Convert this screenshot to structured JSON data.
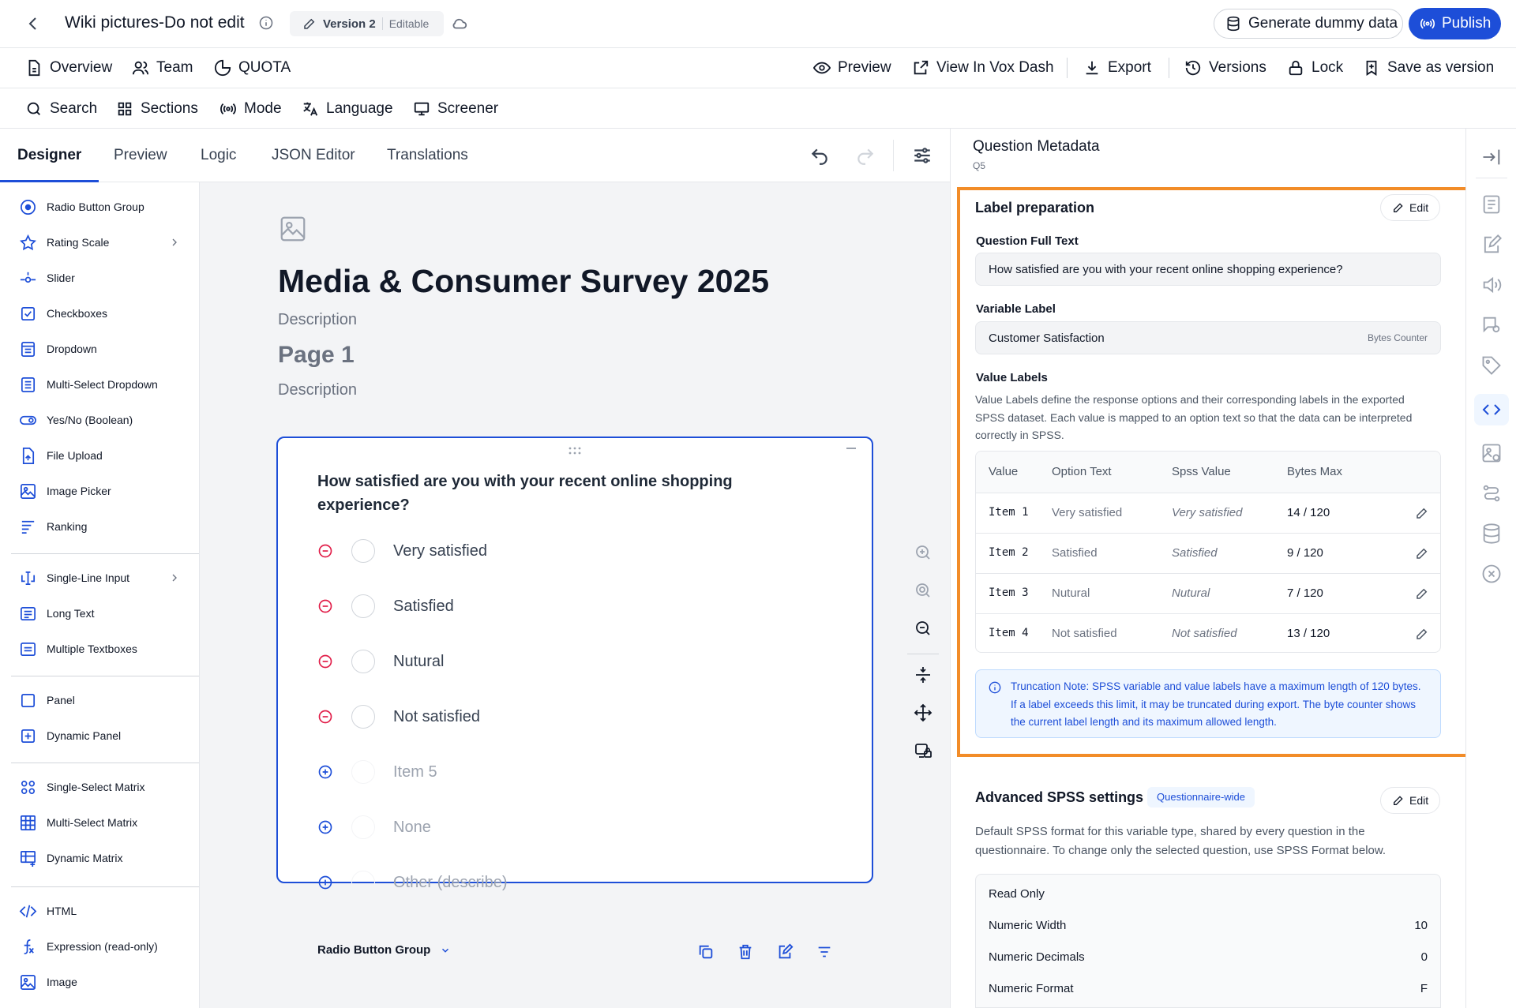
{
  "header": {
    "title": "Wiki pictures-Do not edit",
    "version_label": "Version 2",
    "version_status": "Editable",
    "generate_label": "Generate dummy data",
    "publish_label": "Publish"
  },
  "nav": {
    "left": [
      "Overview",
      "Team",
      "QUOTA"
    ],
    "right": [
      "Preview",
      "View In Vox Dash",
      "Export",
      "Versions",
      "Lock",
      "Save as version"
    ]
  },
  "toolbar": [
    "Search",
    "Sections",
    "Mode",
    "Language",
    "Screener"
  ],
  "tabs": [
    "Designer",
    "Preview",
    "Logic",
    "JSON Editor",
    "Translations"
  ],
  "toolbox": [
    "Radio Button Group",
    "Rating Scale",
    "Slider",
    "Checkboxes",
    "Dropdown",
    "Multi-Select Dropdown",
    "Yes/No (Boolean)",
    "File Upload",
    "Image Picker",
    "Ranking",
    "Single-Line Input",
    "Long Text",
    "Multiple Textboxes",
    "Panel",
    "Dynamic Panel",
    "Single-Select Matrix",
    "Multi-Select Matrix",
    "Dynamic Matrix",
    "HTML",
    "Expression (read-only)",
    "Image"
  ],
  "survey": {
    "title": "Media & Consumer Survey 2025",
    "description": "Description",
    "page_title": "Page 1",
    "page_description": "Description",
    "question": "How satisfied are you with your recent online shopping experience?",
    "choices": [
      "Very satisfied",
      "Satisfied",
      "Nutural",
      "Not satisfied"
    ],
    "placeholders": [
      "Item 5",
      "None",
      "Other (describe)"
    ],
    "question_type": "Radio Button Group"
  },
  "metadata": {
    "title": "Question Metadata",
    "qid": "Q5",
    "label_prep": {
      "title": "Label preparation",
      "edit": "Edit",
      "full_text_label": "Question Full Text",
      "full_text": "How satisfied are you with your recent online shopping experience?",
      "variable_label_title": "Variable Label",
      "variable_label": "Customer Satisfaction",
      "bytes_counter": "Bytes Counter",
      "value_labels_title": "Value Labels",
      "value_labels_desc": "Value Labels define the response options and their corresponding labels in the exported SPSS dataset. Each value is mapped to an option text so that the data can be interpreted correctly in SPSS.",
      "columns": [
        "Value",
        "Option Text",
        "Spss Value",
        "Bytes Max"
      ],
      "rows": [
        {
          "value": "Item 1",
          "option": "Very satisfied",
          "spss": "Very satisfied",
          "bytes": "14 / 120"
        },
        {
          "value": "Item 2",
          "option": "Satisfied",
          "spss": "Satisfied",
          "bytes": "9 / 120"
        },
        {
          "value": "Item 3",
          "option": "Nutural",
          "spss": "Nutural",
          "bytes": "7 / 120"
        },
        {
          "value": "Item 4",
          "option": "Not satisfied",
          "spss": "Not satisfied",
          "bytes": "13 / 120"
        }
      ],
      "note": "Truncation Note: SPSS variable and value labels have a maximum length of 120 bytes. If a label exceeds this limit, it may be truncated during export. The byte counter shows the current label length and its maximum allowed length."
    },
    "advanced": {
      "title": "Advanced SPSS settings",
      "badge": "Questionnaire-wide",
      "edit": "Edit",
      "desc": "Default SPSS format for this variable type, shared by every question in the questionnaire. To change only the selected question, use SPSS Format below.",
      "read_only": "Read Only",
      "settings": [
        {
          "label": "Numeric Width",
          "value": "10"
        },
        {
          "label": "Numeric Decimals",
          "value": "0"
        },
        {
          "label": "Numeric Format",
          "value": "F"
        }
      ]
    }
  },
  "colors": {
    "accent": "#1d4ed8",
    "highlight": "#f28c28",
    "danger": "#e11d48"
  }
}
